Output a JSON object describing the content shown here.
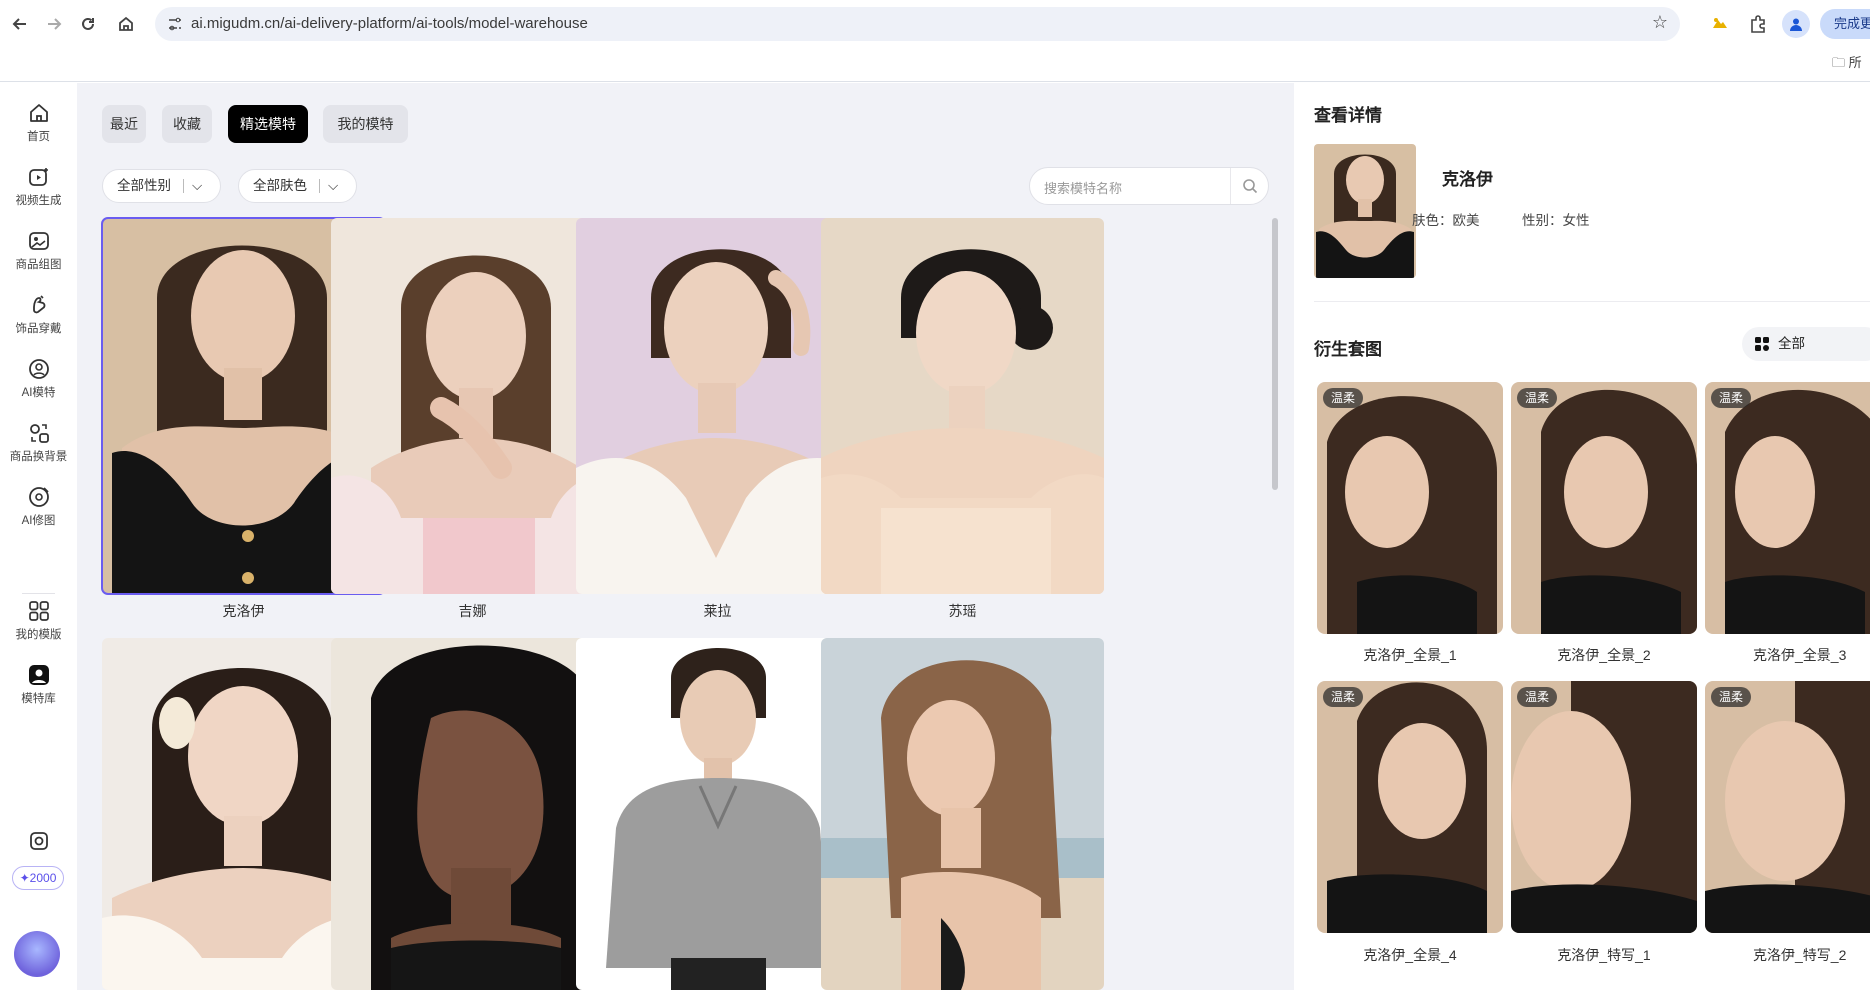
{
  "browser": {
    "url": "ai.migudm.cn/ai-delivery-platform/ai-tools/model-warehouse",
    "update_label": "完成更",
    "bookmark_folder": "所"
  },
  "sidebar": {
    "items": [
      {
        "label": "首页",
        "icon": "home-icon"
      },
      {
        "label": "视频生成",
        "icon": "video-icon"
      },
      {
        "label": "商品组图",
        "icon": "image-group-icon"
      },
      {
        "label": "饰品穿戴",
        "icon": "accessory-icon"
      },
      {
        "label": "AI模特",
        "icon": "ai-model-icon"
      },
      {
        "label": "商品换背景",
        "icon": "background-swap-icon"
      },
      {
        "label": "AI修图",
        "icon": "retouch-icon"
      },
      {
        "label": "我的模版",
        "icon": "template-icon"
      },
      {
        "label": "模特库",
        "icon": "model-library-icon"
      }
    ],
    "credits": "✦2000"
  },
  "tabs": [
    {
      "label": "最近"
    },
    {
      "label": "收藏"
    },
    {
      "label": "精选模特"
    },
    {
      "label": "我的模特"
    }
  ],
  "filters": {
    "gender": "全部性别",
    "skin": "全部肤色"
  },
  "search": {
    "placeholder": "搜索模特名称"
  },
  "models": [
    {
      "name": "克洛伊"
    },
    {
      "name": "吉娜"
    },
    {
      "name": "莱拉"
    },
    {
      "name": "苏瑶"
    }
  ],
  "detail": {
    "title": "查看详情",
    "name": "克洛伊",
    "skin_label": "肤色：",
    "skin_value": "欧美",
    "gender_label": "性别：",
    "gender_value": "女性",
    "derivatives_title": "衍生套图",
    "dropdown": "全部",
    "derivatives": [
      {
        "tag": "温柔",
        "name": "克洛伊_全景_1"
      },
      {
        "tag": "温柔",
        "name": "克洛伊_全景_2"
      },
      {
        "tag": "温柔",
        "name": "克洛伊_全景_3"
      },
      {
        "tag": "温柔",
        "name": "克洛伊_全景_4"
      },
      {
        "tag": "温柔",
        "name": "克洛伊_特写_1"
      },
      {
        "tag": "温柔",
        "name": "克洛伊_特写_2"
      }
    ]
  },
  "colors": {
    "accent": "#6a5cf0",
    "active_tab": "#000000",
    "main_bg": "#f1f2f7"
  }
}
